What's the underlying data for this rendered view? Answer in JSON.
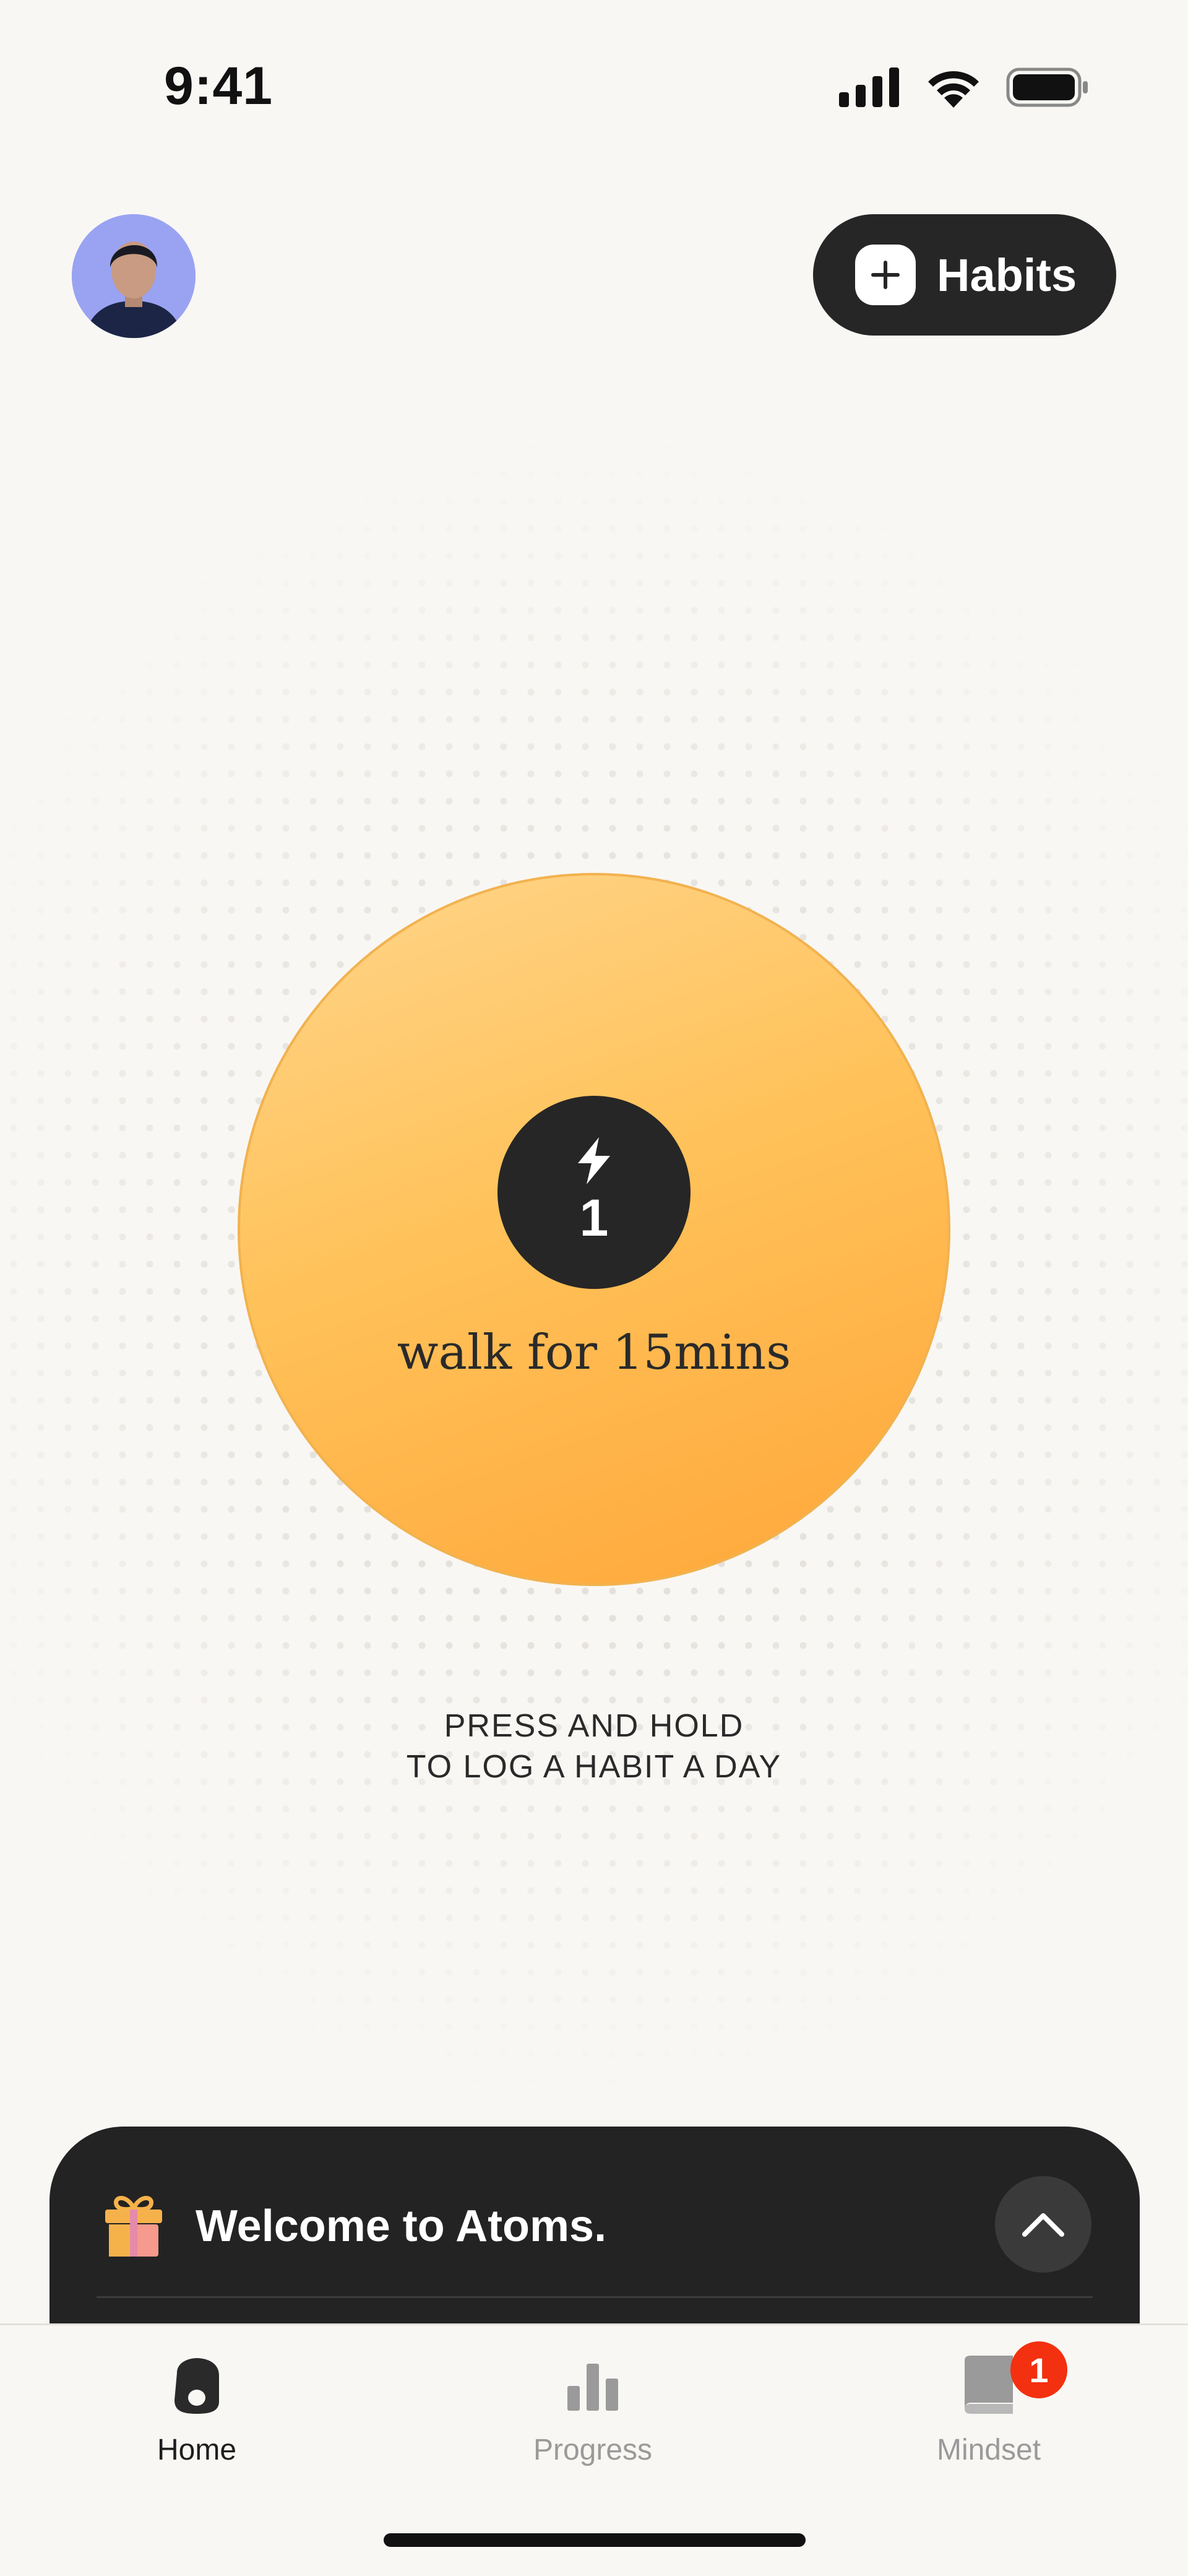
{
  "status_bar": {
    "time": "9:41"
  },
  "header": {
    "habits_button_label": "Habits"
  },
  "habit": {
    "streak": "1",
    "name": "walk for 15mins"
  },
  "instructions": {
    "line1": "PRESS AND HOLD",
    "line2": "TO LOG A HABIT A DAY"
  },
  "welcome": {
    "title": "Welcome to Atoms."
  },
  "tabs": [
    {
      "label": "Home",
      "icon": "home-icon",
      "active": true
    },
    {
      "label": "Progress",
      "icon": "bar-chart-icon",
      "active": false
    },
    {
      "label": "Mindset",
      "icon": "book-icon",
      "active": false,
      "badge": "1"
    }
  ],
  "colors": {
    "background": "#f9f7f4",
    "accent_orange": "#ffb347",
    "dark": "#262626",
    "badge_red": "#f3300f"
  }
}
